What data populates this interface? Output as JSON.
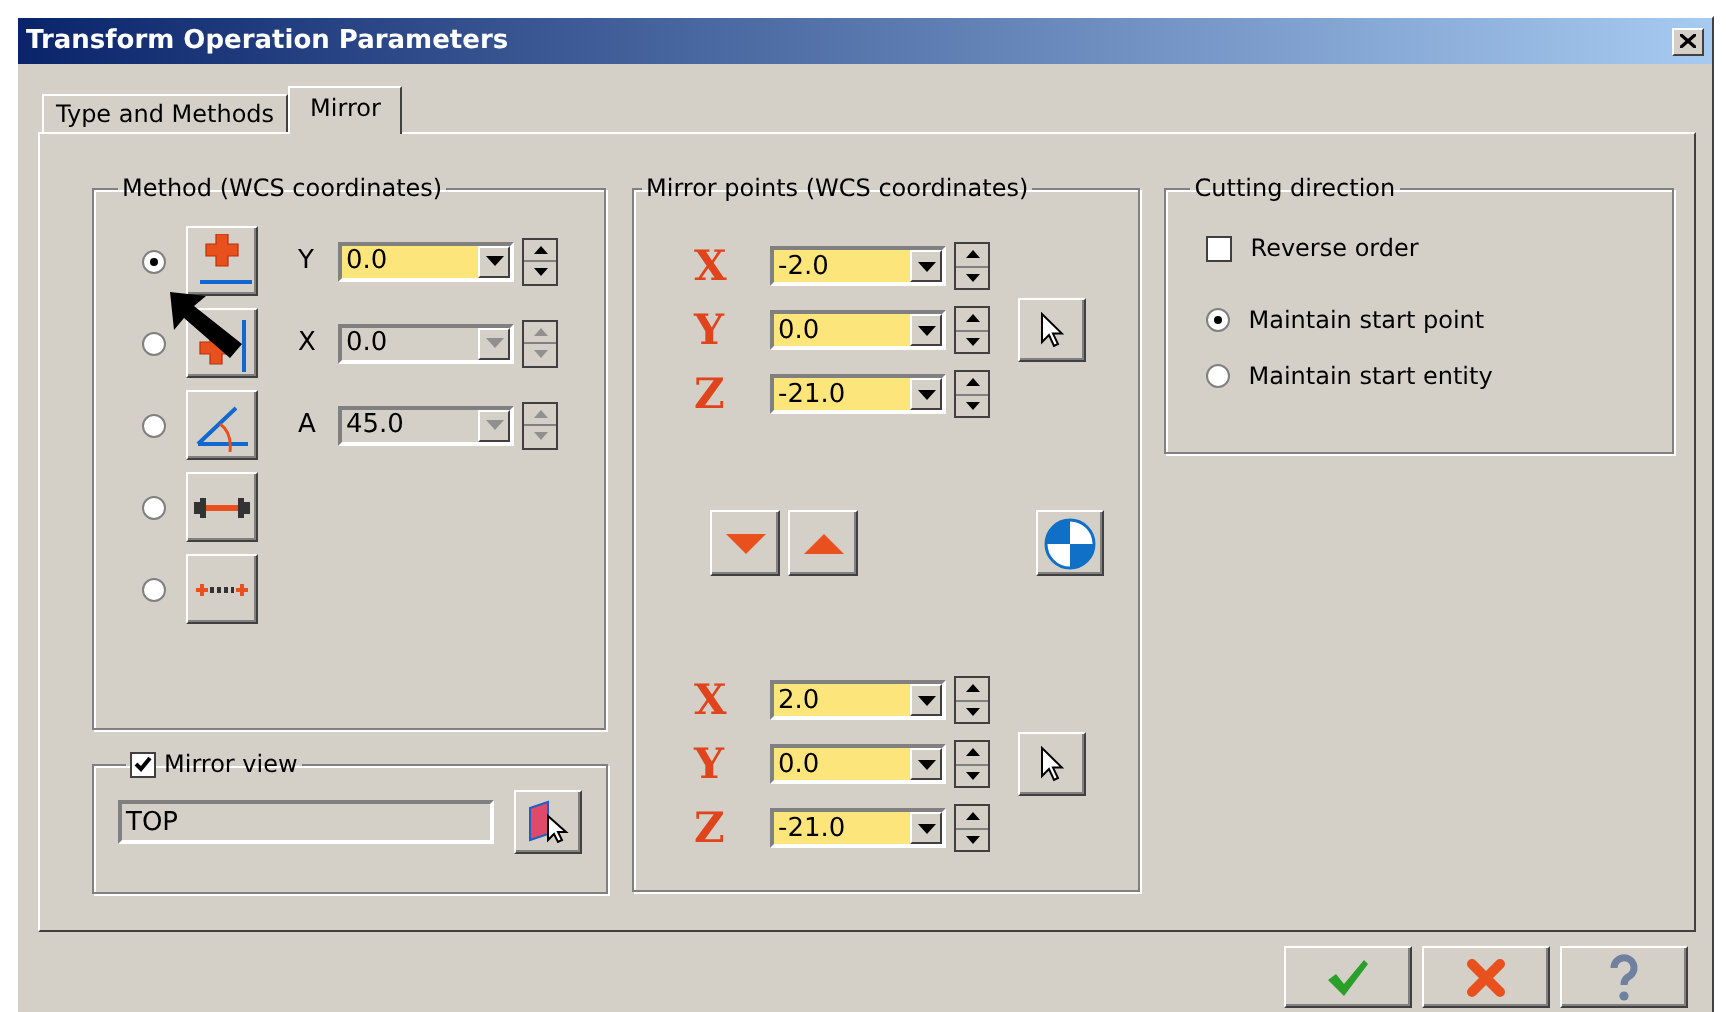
{
  "window": {
    "title": "Transform Operation Parameters"
  },
  "tabs": [
    {
      "label": "Type and Methods",
      "selected": false
    },
    {
      "label": "Mirror",
      "selected": true
    }
  ],
  "method": {
    "title": "Method (WCS coordinates)",
    "options": [
      {
        "kind": "y-axis",
        "selected": true,
        "field": {
          "label": "Y",
          "value": "0.0",
          "disabled": false
        }
      },
      {
        "kind": "x-axis",
        "selected": false,
        "field": {
          "label": "X",
          "value": "0.0",
          "disabled": true
        }
      },
      {
        "kind": "angle",
        "selected": false,
        "field": {
          "label": "A",
          "value": "45.0",
          "disabled": true
        }
      },
      {
        "kind": "line",
        "selected": false
      },
      {
        "kind": "points",
        "selected": false
      }
    ]
  },
  "mirror_view": {
    "label": "Mirror view",
    "checked": true,
    "value": "TOP"
  },
  "mirror_points": {
    "title": "Mirror points (WCS coordinates)",
    "points": [
      {
        "coords": [
          {
            "axis": "X",
            "value": "-2.0"
          },
          {
            "axis": "Y",
            "value": "0.0"
          },
          {
            "axis": "Z",
            "value": "-21.0"
          }
        ]
      },
      {
        "coords": [
          {
            "axis": "X",
            "value": "2.0"
          },
          {
            "axis": "Y",
            "value": "0.0"
          },
          {
            "axis": "Z",
            "value": "-21.0"
          }
        ]
      }
    ]
  },
  "cutting_direction": {
    "title": "Cutting direction",
    "reverse_order": {
      "label": "Reverse order",
      "checked": false
    },
    "options": [
      {
        "label": "Maintain start point",
        "selected": true
      },
      {
        "label": "Maintain start entity",
        "selected": false
      }
    ]
  },
  "buttons": [
    {
      "kind": "ok"
    },
    {
      "kind": "cancel"
    },
    {
      "kind": "help"
    }
  ]
}
